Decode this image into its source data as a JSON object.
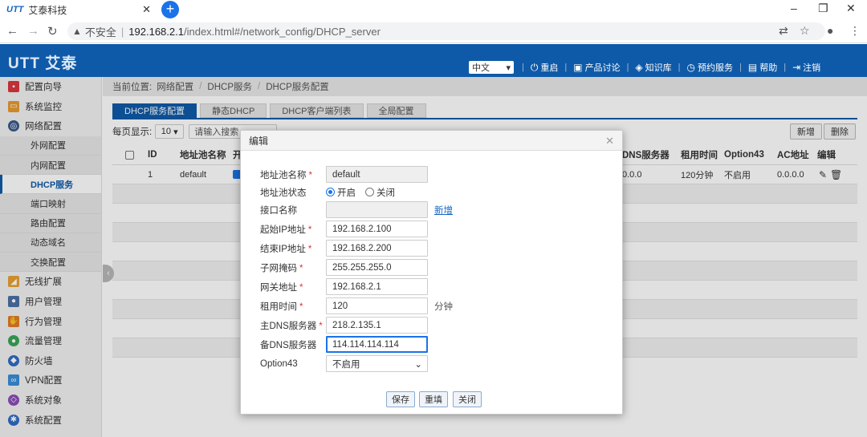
{
  "browser": {
    "tab_title": "艾泰科技",
    "tab_favicon": "UTT",
    "new_tab_label": "+",
    "url_warning": "不安全",
    "url_host": "192.168.2.1",
    "url_path": "/index.html#/network_config/DHCP_server"
  },
  "header": {
    "logo": "UTT 艾泰",
    "language": "中文",
    "links": [
      "重启",
      "产品讨论",
      "知识库",
      "预约服务",
      "帮助",
      "注销"
    ]
  },
  "sidebar": {
    "items": [
      {
        "label": "配置向导",
        "icon": "flag-icon",
        "color": "#d9363e"
      },
      {
        "label": "系统监控",
        "icon": "monitor-icon",
        "color": "#e89a2e"
      },
      {
        "label": "网络配置",
        "icon": "globe-icon",
        "color": "#3a5a8c"
      }
    ],
    "subitems": [
      "外网配置",
      "内网配置",
      "DHCP服务",
      "端口映射",
      "路由配置",
      "动态域名",
      "交换配置"
    ],
    "active_sub": "DHCP服务",
    "items2": [
      {
        "label": "无线扩展",
        "icon": "wifi-icon",
        "color": "#e8a033"
      },
      {
        "label": "用户管理",
        "icon": "users-icon",
        "color": "#4a6fa5"
      },
      {
        "label": "行为管理",
        "icon": "hand-icon",
        "color": "#e07b2a"
      },
      {
        "label": "流量管理",
        "icon": "traffic-icon",
        "color": "#3aa655"
      },
      {
        "label": "防火墙",
        "icon": "shield-icon",
        "color": "#2f6cc4"
      },
      {
        "label": "VPN配置",
        "icon": "vpn-icon",
        "color": "#3b8ed8"
      },
      {
        "label": "系统对象",
        "icon": "cube-icon",
        "color": "#8a4fb8"
      },
      {
        "label": "系统配置",
        "icon": "gear-icon",
        "color": "#2f6cc4"
      }
    ]
  },
  "breadcrumb": {
    "prefix": "当前位置:",
    "parts": [
      "网络配置",
      "DHCP服务",
      "DHCP服务配置"
    ]
  },
  "tabs": [
    "DHCP服务配置",
    "静态DHCP",
    "DHCP客户端列表",
    "全局配置"
  ],
  "toolbar": {
    "per_page_label": "每页显示:",
    "per_page_value": "10",
    "search_placeholder": "请输入搜索",
    "add_label": "新增",
    "delete_label": "删除"
  },
  "table": {
    "headers": {
      "id": "ID",
      "name": "地址池名称",
      "enable": "开",
      "dns": "DNS服务器",
      "lease": "租用时间",
      "option43": "Option43",
      "ac": "AC地址",
      "edit": "编辑"
    },
    "rows": [
      {
        "id": "1",
        "name": "default",
        "dns": "0.0.0",
        "lease": "120分钟",
        "option43": "不启用",
        "ac": "0.0.0.0"
      }
    ]
  },
  "modal": {
    "title": "编辑",
    "fields": {
      "pool_name": {
        "label": "地址池名称",
        "value": "default"
      },
      "pool_status": {
        "label": "地址池状态",
        "on": "开启",
        "off": "关闭"
      },
      "interface": {
        "label": "接口名称",
        "value": "",
        "link": "新增"
      },
      "start_ip": {
        "label": "起始IP地址",
        "value": "192.168.2.100"
      },
      "end_ip": {
        "label": "结束IP地址",
        "value": "192.168.2.200"
      },
      "netmask": {
        "label": "子网掩码",
        "value": "255.255.255.0"
      },
      "gateway": {
        "label": "网关地址",
        "value": "192.168.2.1"
      },
      "lease": {
        "label": "租用时间",
        "value": "120",
        "unit": "分钟"
      },
      "dns1": {
        "label": "主DNS服务器",
        "value": "218.2.135.1"
      },
      "dns2": {
        "label": "备DNS服务器",
        "value": "114.114.114.114"
      },
      "option43": {
        "label": "Option43",
        "value": "不启用"
      }
    },
    "buttons": {
      "save": "保存",
      "reset": "重填",
      "close": "关闭"
    }
  }
}
